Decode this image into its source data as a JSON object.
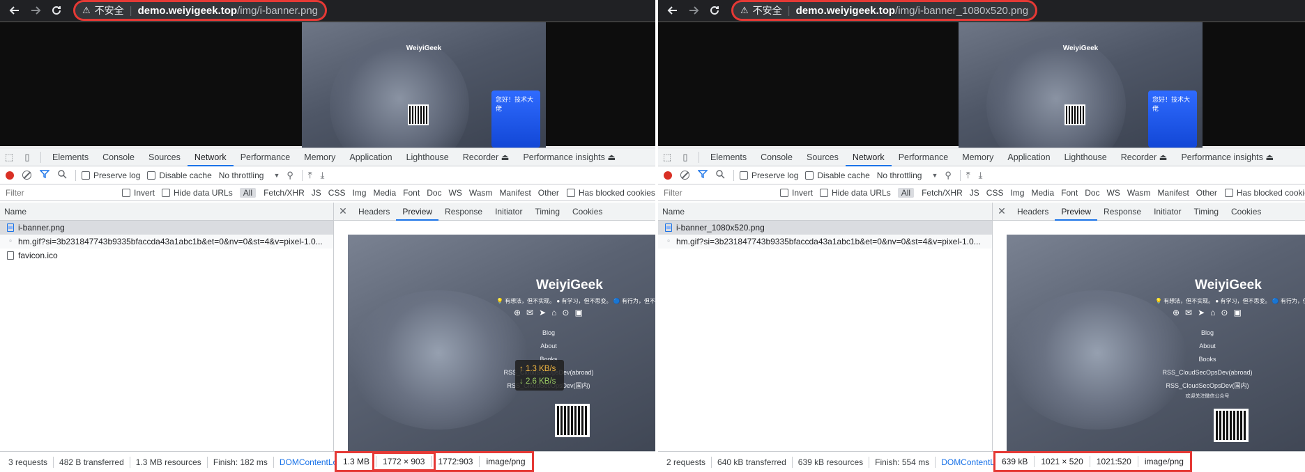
{
  "common": {
    "insecure_label": "不安全",
    "devtools_tabs": [
      "Elements",
      "Console",
      "Sources",
      "Network",
      "Performance",
      "Memory",
      "Application",
      "Lighthouse",
      "Recorder ⏏",
      "Performance insights ⏏"
    ],
    "active_tab": "Network",
    "controls": {
      "preserve_log": "Preserve log",
      "disable_cache": "Disable cache",
      "throttling": "No throttling"
    },
    "filter": {
      "placeholder": "Filter",
      "invert": "Invert",
      "hide_data_urls": "Hide data URLs",
      "types": [
        "All",
        "Fetch/XHR",
        "JS",
        "CSS",
        "Img",
        "Media",
        "Font",
        "Doc",
        "WS",
        "Wasm",
        "Manifest",
        "Other"
      ],
      "has_blocked_cookies": "Has blocked cookies"
    },
    "name_header": "Name",
    "detail_tabs": [
      "Headers",
      "Preview",
      "Response",
      "Initiator",
      "Timing",
      "Cookies"
    ],
    "active_detail_tab": "Preview",
    "banner": {
      "title": "WeiyiGeek",
      "tagline": "💡 有想法，但不实现。  ● 有学习，但不思变。  🔵 有行为，但不作为。",
      "links": [
        "Blog",
        "About",
        "Books",
        "RSS_CloudSecOpsDev(abroad)",
        "RSS_CloudSecOpsDev(国内)"
      ],
      "wechat_label": "欢迎关注微信公众号",
      "card_text": "您好！技术大佬"
    }
  },
  "left": {
    "url_host": "demo.weiyigeek.top",
    "url_path": "/img/i-banner.png",
    "requests": [
      {
        "name": "i-banner.png",
        "icon": "image-file-icon",
        "selected": true
      },
      {
        "name": "hm.gif?si=3b231847743b9335bfaccda43a1abc1b&et=0&nv=0&st=4&v=pixel-1.0...",
        "icon": "dot-icon",
        "selected": false
      },
      {
        "name": "favicon.ico",
        "icon": "file-icon",
        "selected": false
      }
    ],
    "status": [
      "3 requests",
      "482 B transferred",
      "1.3 MB resources",
      "Finish: 182 ms",
      "DOMContentLoaded"
    ],
    "image_info": {
      "size": "1.3 MB",
      "dimensions": "1772 × 903",
      "ratio": "1772:903",
      "mime": "image/png"
    },
    "speed": {
      "up": "↑ 1.3 KB/s",
      "down": "↓ 2.6 KB/s"
    }
  },
  "right": {
    "url_host": "demo.weiyigeek.top",
    "url_path": "/img/i-banner_1080x520.png",
    "requests": [
      {
        "name": "i-banner_1080x520.png",
        "icon": "image-file-icon",
        "selected": true
      },
      {
        "name": "hm.gif?si=3b231847743b9335bfaccda43a1abc1b&et=0&nv=0&st=4&v=pixel-1.0...",
        "icon": "dot-icon",
        "selected": false
      }
    ],
    "status": [
      "2 requests",
      "640 kB transferred",
      "639 kB resources",
      "Finish: 554 ms",
      "DOMContentLoaded"
    ],
    "image_info": {
      "size": "639 kB",
      "dimensions": "1021 × 520",
      "ratio": "1021:520",
      "mime": "image/png"
    }
  }
}
